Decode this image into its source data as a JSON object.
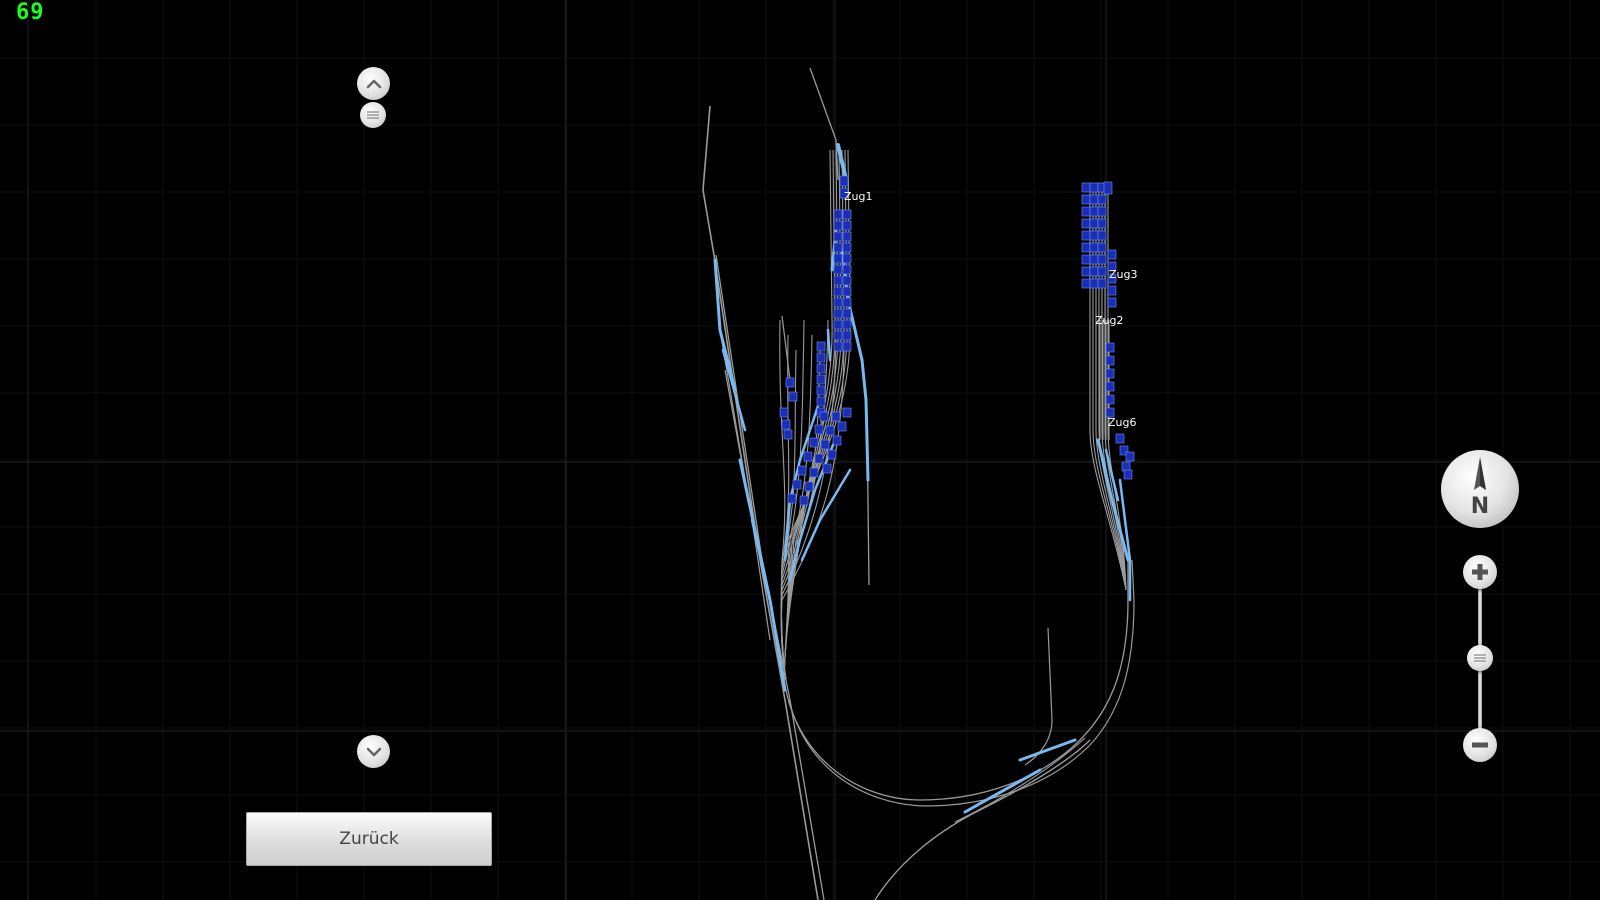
{
  "hud": {
    "fps": "69"
  },
  "navigation": {
    "scroll_up": "chevron-up-icon",
    "scroll_handle": "grip-icon",
    "scroll_down": "chevron-down-icon",
    "back_label": "Zurück"
  },
  "map_controls": {
    "compass_label": "N",
    "zoom_in": "plus-icon",
    "zoom_out": "minus-icon"
  },
  "trains": [
    {
      "label": "Zug1"
    },
    {
      "label": "Zug3"
    },
    {
      "label": "Zug2"
    },
    {
      "label": "Zug6"
    }
  ],
  "colors": {
    "background": "#000000",
    "grid": "#1e1e1e",
    "track": "#9a9a9a",
    "occupied_track": "#7ab8f0",
    "wagon": "#1a2fb5",
    "fps_text": "#19ff19"
  }
}
